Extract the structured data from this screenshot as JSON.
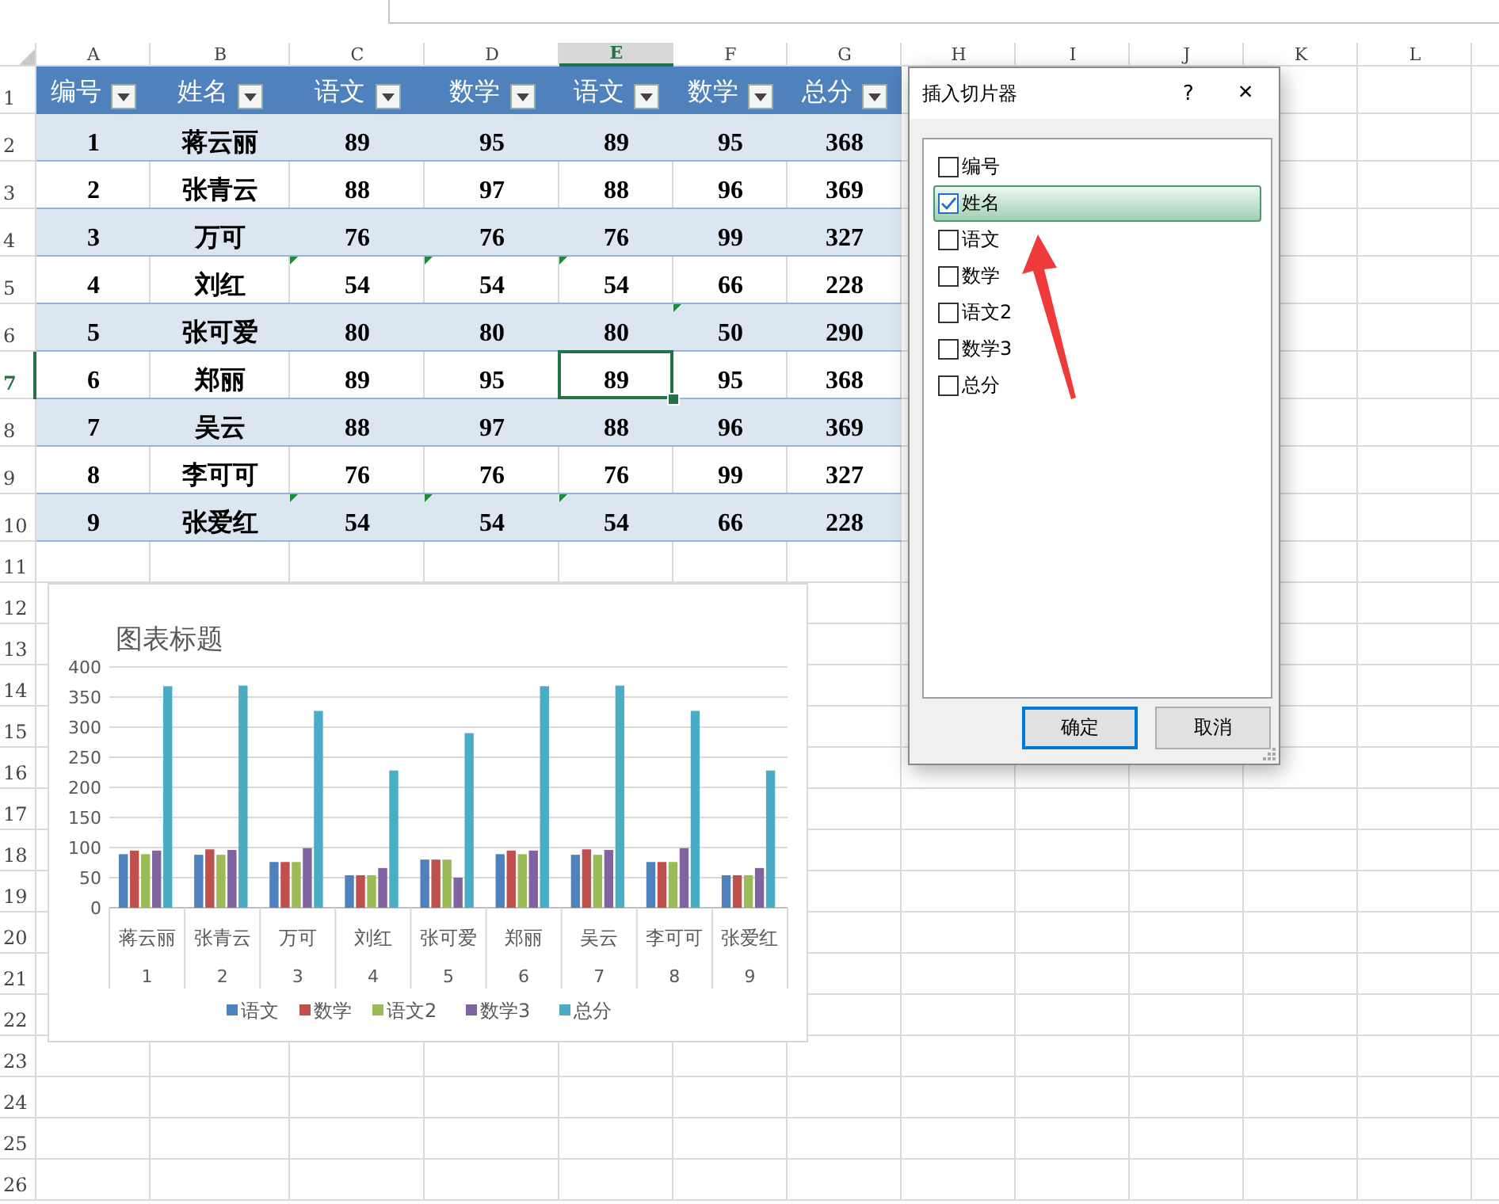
{
  "sheet": {
    "columns": [
      {
        "label": "A",
        "selected": false
      },
      {
        "label": "B",
        "selected": false
      },
      {
        "label": "C",
        "selected": false
      },
      {
        "label": "D",
        "selected": false
      },
      {
        "label": "E",
        "selected": true
      },
      {
        "label": "F",
        "selected": false
      },
      {
        "label": "G",
        "selected": false
      },
      {
        "label": "H",
        "selected": false
      },
      {
        "label": "I",
        "selected": false
      },
      {
        "label": "J",
        "selected": false
      },
      {
        "label": "K",
        "selected": false
      },
      {
        "label": "L",
        "selected": false
      }
    ],
    "rows": [
      {
        "label": "1",
        "selected": false
      },
      {
        "label": "2",
        "selected": false
      },
      {
        "label": "3",
        "selected": false
      },
      {
        "label": "4",
        "selected": false
      },
      {
        "label": "5",
        "selected": false
      },
      {
        "label": "6",
        "selected": false
      },
      {
        "label": "7",
        "selected": true
      },
      {
        "label": "8",
        "selected": false
      },
      {
        "label": "9",
        "selected": false
      },
      {
        "label": "10",
        "selected": false
      },
      {
        "label": "11",
        "selected": false
      },
      {
        "label": "12",
        "selected": false
      },
      {
        "label": "13",
        "selected": false
      },
      {
        "label": "14",
        "selected": false
      },
      {
        "label": "15",
        "selected": false
      },
      {
        "label": "16",
        "selected": false
      },
      {
        "label": "17",
        "selected": false
      },
      {
        "label": "18",
        "selected": false
      },
      {
        "label": "19",
        "selected": false
      },
      {
        "label": "20",
        "selected": false
      },
      {
        "label": "21",
        "selected": false
      },
      {
        "label": "22",
        "selected": false
      },
      {
        "label": "23",
        "selected": false
      },
      {
        "label": "24",
        "selected": false
      },
      {
        "label": "25",
        "selected": false
      },
      {
        "label": "26",
        "selected": false
      }
    ]
  },
  "table": {
    "headers": [
      "编号",
      "姓名",
      "语文",
      "数学",
      "语文",
      "数学",
      "总分"
    ],
    "rows": [
      {
        "cells": [
          {
            "text": "1"
          },
          {
            "text": "蒋云丽"
          },
          {
            "text": "89"
          },
          {
            "text": "95"
          },
          {
            "text": "89"
          },
          {
            "text": "95"
          },
          {
            "text": "368"
          }
        ]
      },
      {
        "cells": [
          {
            "text": "2"
          },
          {
            "text": "张青云"
          },
          {
            "text": "88"
          },
          {
            "text": "97"
          },
          {
            "text": "88"
          },
          {
            "text": "96"
          },
          {
            "text": "369"
          }
        ]
      },
      {
        "cells": [
          {
            "text": "3"
          },
          {
            "text": "万可"
          },
          {
            "text": "76"
          },
          {
            "text": "76"
          },
          {
            "text": "76"
          },
          {
            "text": "99"
          },
          {
            "text": "327"
          }
        ]
      },
      {
        "cells": [
          {
            "text": "4"
          },
          {
            "text": "刘红"
          },
          {
            "text": "54",
            "flagged": true
          },
          {
            "text": "54",
            "flagged": true
          },
          {
            "text": "54",
            "flagged": true
          },
          {
            "text": "66"
          },
          {
            "text": "228"
          }
        ]
      },
      {
        "cells": [
          {
            "text": "5"
          },
          {
            "text": "张可爱"
          },
          {
            "text": "80"
          },
          {
            "text": "80"
          },
          {
            "text": "80"
          },
          {
            "text": "50",
            "flagged": true
          },
          {
            "text": "290"
          }
        ]
      },
      {
        "cells": [
          {
            "text": "6"
          },
          {
            "text": "郑丽"
          },
          {
            "text": "89"
          },
          {
            "text": "95"
          },
          {
            "text": "89"
          },
          {
            "text": "95"
          },
          {
            "text": "368"
          }
        ]
      },
      {
        "cells": [
          {
            "text": "7"
          },
          {
            "text": "吴云"
          },
          {
            "text": "88"
          },
          {
            "text": "97"
          },
          {
            "text": "88"
          },
          {
            "text": "96"
          },
          {
            "text": "369"
          }
        ]
      },
      {
        "cells": [
          {
            "text": "8"
          },
          {
            "text": "李可可"
          },
          {
            "text": "76"
          },
          {
            "text": "76"
          },
          {
            "text": "76"
          },
          {
            "text": "99"
          },
          {
            "text": "327"
          }
        ]
      },
      {
        "cells": [
          {
            "text": "9"
          },
          {
            "text": "张爱红"
          },
          {
            "text": "54",
            "flagged": true
          },
          {
            "text": "54",
            "flagged": true
          },
          {
            "text": "54",
            "flagged": true
          },
          {
            "text": "66"
          },
          {
            "text": "228"
          }
        ]
      }
    ]
  },
  "chart": {
    "category_numbers": [
      "1",
      "2",
      "3",
      "4",
      "5",
      "6",
      "7",
      "8",
      "9"
    ],
    "chart_data": {
      "type": "bar",
      "title": "图表标题",
      "categories": [
        "蒋云丽",
        "张青云",
        "万可",
        "刘红",
        "张可爱",
        "郑丽",
        "吴云",
        "李可可",
        "张爱红"
      ],
      "series": [
        {
          "name": "语文",
          "color": "#4f81bd",
          "values": [
            89,
            88,
            76,
            54,
            80,
            89,
            88,
            76,
            54
          ]
        },
        {
          "name": "数学",
          "color": "#c0504d",
          "values": [
            95,
            97,
            76,
            54,
            80,
            95,
            97,
            76,
            54
          ]
        },
        {
          "name": "语文2",
          "color": "#9bbb59",
          "values": [
            89,
            88,
            76,
            54,
            80,
            89,
            88,
            76,
            54
          ]
        },
        {
          "name": "数学3",
          "color": "#8064a2",
          "values": [
            95,
            96,
            99,
            66,
            50,
            95,
            96,
            99,
            66
          ]
        },
        {
          "name": "总分",
          "color": "#4bacc6",
          "values": [
            368,
            369,
            327,
            228,
            290,
            368,
            369,
            327,
            228
          ]
        }
      ],
      "ylim": [
        0,
        400
      ],
      "yticks": [
        0,
        50,
        100,
        150,
        200,
        250,
        300,
        350,
        400
      ],
      "grid": true,
      "legend": true
    }
  },
  "dialog": {
    "title": "插入切片器",
    "help": "?",
    "close": "×",
    "items": [
      {
        "label": "编号",
        "checked": false,
        "selected": false
      },
      {
        "label": "姓名",
        "checked": true,
        "selected": true
      },
      {
        "label": "语文",
        "checked": false,
        "selected": false
      },
      {
        "label": "数学",
        "checked": false,
        "selected": false
      },
      {
        "label": "语文2",
        "checked": false,
        "selected": false
      },
      {
        "label": "数学3",
        "checked": false,
        "selected": false
      },
      {
        "label": "总分",
        "checked": false,
        "selected": false
      }
    ],
    "buttons": [
      {
        "label": "确定",
        "default": true
      },
      {
        "label": "取消",
        "default": false
      }
    ]
  }
}
